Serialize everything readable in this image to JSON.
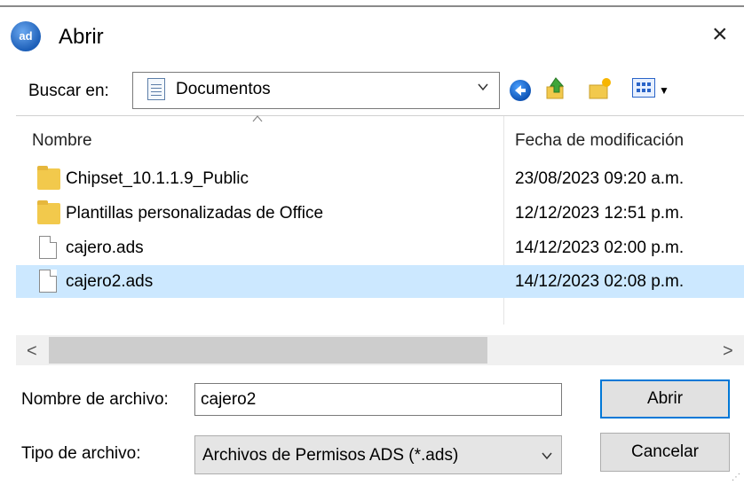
{
  "window": {
    "title": "Abrir",
    "close_glyph": "×",
    "app_icon_text": "ad"
  },
  "lookin": {
    "label": "Buscar en:",
    "value": "Documentos"
  },
  "toolbar": {
    "icons": [
      "back-icon",
      "up-folder-icon",
      "new-folder-icon",
      "view-menu-icon"
    ]
  },
  "list": {
    "headers": {
      "name": "Nombre",
      "date": "Fecha de modificación"
    },
    "rows": [
      {
        "name": "Chipset_10.1.1.9_Public",
        "date": "23/08/2023 09:20 a.m.",
        "type": "folder"
      },
      {
        "name": "Plantillas personalizadas de Office",
        "date": "12/12/2023 12:51 p.m.",
        "type": "folder"
      },
      {
        "name": "cajero.ads",
        "date": "14/12/2023 02:00 p.m.",
        "type": "file"
      },
      {
        "name": "cajero2.ads",
        "date": "14/12/2023 02:08 p.m.",
        "type": "file",
        "selected": true
      }
    ]
  },
  "scrollbar": {
    "left_glyph": "<",
    "right_glyph": ">"
  },
  "form": {
    "filename_label": "Nombre de archivo:",
    "filename_value": "cajero2",
    "filetype_label": "Tipo de archivo:",
    "filetype_value": "Archivos de Permisos ADS (*.ads)"
  },
  "buttons": {
    "open": "Abrir",
    "cancel": "Cancelar"
  },
  "colors": {
    "selection": "#cce8ff",
    "accent": "#0078d7",
    "folder": "#f2c94c"
  }
}
